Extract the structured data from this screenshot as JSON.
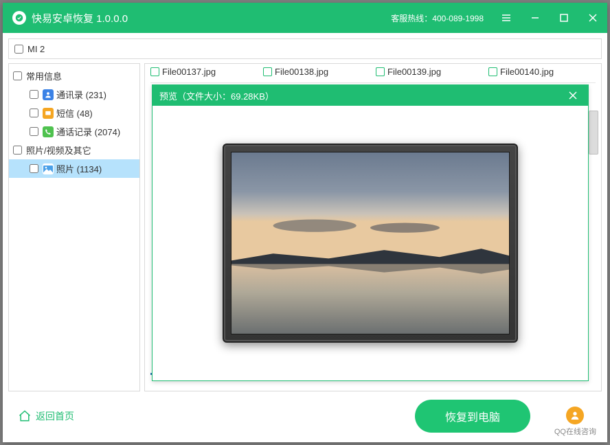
{
  "titlebar": {
    "title": "快易安卓恢复  1.0.0.0",
    "hotline": "客服热线：400-089-1998"
  },
  "device": {
    "name": "MI 2"
  },
  "sidebar": {
    "group1": {
      "label": "常用信息"
    },
    "contacts": {
      "label": "通讯录 (231)"
    },
    "sms": {
      "label": "短信 (48)"
    },
    "calls": {
      "label": "通话记录 (2074)"
    },
    "group2": {
      "label": "照片/视频及其它"
    },
    "photos": {
      "label": "照片 (1134)"
    }
  },
  "files": {
    "f1": "File00137.jpg",
    "f2": "File00138.jpg",
    "f3": "File00139.jpg",
    "f4": "File00140.jpg"
  },
  "preview": {
    "title": "预览（文件大小：69.28KB）"
  },
  "footer": {
    "back": "返回首页",
    "recover": "恢复到电脑",
    "qq": "QQ在线咨询"
  }
}
